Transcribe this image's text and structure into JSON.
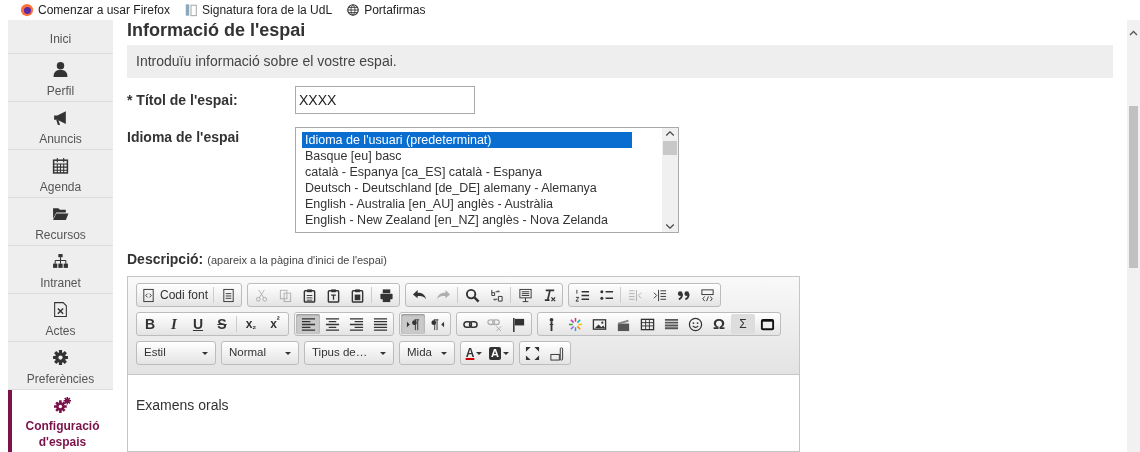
{
  "bookmarks": [
    {
      "label": "Comenzar a usar Firefox"
    },
    {
      "label": "Signatura fora de la UdL"
    },
    {
      "label": "Portafirmas"
    }
  ],
  "sidebar": {
    "items": [
      {
        "label": "Inici",
        "selected": false
      },
      {
        "label": "Perfil",
        "selected": false
      },
      {
        "label": "Anuncis",
        "selected": false
      },
      {
        "label": "Agenda",
        "selected": false
      },
      {
        "label": "Recursos",
        "selected": false
      },
      {
        "label": "Intranet",
        "selected": false
      },
      {
        "label": "Actes",
        "selected": false
      },
      {
        "label": "Preferències",
        "selected": false
      },
      {
        "label": "Configuració d'espais",
        "selected": true
      }
    ]
  },
  "heading": "Informació de l'espai",
  "info": "Introduïu informació sobre el vostre espai.",
  "title_field": {
    "label": "* Títol de l'espai:",
    "value": "XXXX"
  },
  "language_field": {
    "label": "Idioma de l'espai",
    "options": [
      {
        "label": "Idioma de l'usuari (predeterminat)",
        "selected": true
      },
      {
        "label": "Basque [eu] basc",
        "selected": false
      },
      {
        "label": "català - Espanya [ca_ES] català - Espanya",
        "selected": false
      },
      {
        "label": "Deutsch - Deutschland [de_DE] alemany - Alemanya",
        "selected": false
      },
      {
        "label": "English - Australia [en_AU] anglès - Austràlia",
        "selected": false
      },
      {
        "label": "English - New Zealand [en_NZ] anglès - Nova Zelanda",
        "selected": false
      }
    ]
  },
  "description": {
    "label": "Descripció:",
    "hint": "(apareix a la pàgina d'inici de l'espai)",
    "content": "Examens orals",
    "toolbar": {
      "rows": [
        {
          "groups": [
            {
              "items": [
                {
                  "kind": "labeled",
                  "label": "Codi font",
                  "active": false,
                  "disabled": false
                },
                {
                  "kind": "separator"
                },
                {
                  "kind": "icon",
                  "active": false,
                  "disabled": false
                }
              ]
            },
            {
              "items": [
                {
                  "kind": "icon",
                  "active": false,
                  "disabled": true
                },
                {
                  "kind": "icon",
                  "active": false,
                  "disabled": true
                },
                {
                  "kind": "icon",
                  "active": false,
                  "disabled": false
                },
                {
                  "kind": "icon",
                  "active": false,
                  "disabled": false
                },
                {
                  "kind": "icon",
                  "active": false,
                  "disabled": false
                },
                {
                  "kind": "separator"
                },
                {
                  "kind": "icon",
                  "active": false,
                  "disabled": false
                }
              ]
            },
            {
              "items": [
                {
                  "kind": "icon",
                  "active": false,
                  "disabled": false
                },
                {
                  "kind": "icon",
                  "active": false,
                  "disabled": true
                },
                {
                  "kind": "separator"
                },
                {
                  "kind": "icon",
                  "active": false,
                  "disabled": false
                },
                {
                  "kind": "icon",
                  "active": false,
                  "disabled": false
                },
                {
                  "kind": "separator"
                },
                {
                  "kind": "icon",
                  "active": false,
                  "disabled": false
                },
                {
                  "kind": "icon",
                  "active": false,
                  "disabled": false
                }
              ]
            },
            {
              "items": [
                {
                  "kind": "icon",
                  "active": false,
                  "disabled": false
                },
                {
                  "kind": "icon",
                  "active": false,
                  "disabled": false
                },
                {
                  "kind": "separator"
                },
                {
                  "kind": "icon",
                  "active": false,
                  "disabled": true
                },
                {
                  "kind": "icon",
                  "active": false,
                  "disabled": false
                },
                {
                  "kind": "icon",
                  "active": false,
                  "disabled": false
                },
                {
                  "kind": "icon",
                  "active": false,
                  "disabled": false
                }
              ]
            }
          ]
        },
        {
          "groups": [
            {
              "items": [
                {
                  "kind": "bold",
                  "label": "B",
                  "active": false,
                  "disabled": false
                },
                {
                  "kind": "italic",
                  "label": "I",
                  "active": false,
                  "disabled": false
                },
                {
                  "kind": "underline",
                  "label": "U",
                  "active": false,
                  "disabled": false
                },
                {
                  "kind": "strike",
                  "label": "S",
                  "active": false,
                  "disabled": false
                },
                {
                  "kind": "separator"
                },
                {
                  "kind": "script",
                  "label": "x$_{₂}$",
                  "active": false,
                  "disabled": false
                },
                {
                  "kind": "script",
                  "label": "x$^{²}$",
                  "active": false,
                  "disabled": false
                }
              ]
            },
            {
              "items": [
                {
                  "kind": "icon",
                  "active": true,
                  "disabled": false
                },
                {
                  "kind": "icon",
                  "active": false,
                  "disabled": false
                },
                {
                  "kind": "icon",
                  "active": false,
                  "disabled": false
                },
                {
                  "kind": "icon",
                  "active": false,
                  "disabled": false
                }
              ]
            },
            {
              "items": [
                {
                  "kind": "icon",
                  "active": true,
                  "disabled": false
                },
                {
                  "kind": "icon",
                  "active": false,
                  "disabled": false
                }
              ]
            },
            {
              "items": [
                {
                  "kind": "icon",
                  "active": false,
                  "disabled": false
                },
                {
                  "kind": "icon",
                  "active": false,
                  "disabled": true
                },
                {
                  "kind": "icon",
                  "active": false,
                  "disabled": false
                }
              ]
            },
            {
              "items": [
                {
                  "kind": "icon",
                  "active": false,
                  "disabled": false
                },
                {
                  "kind": "icon",
                  "active": false,
                  "disabled": false
                },
                {
                  "kind": "icon",
                  "active": false,
                  "disabled": false
                },
                {
                  "kind": "icon",
                  "active": false,
                  "disabled": false
                },
                {
                  "kind": "icon",
                  "active": false,
                  "disabled": false
                },
                {
                  "kind": "icon",
                  "active": false,
                  "disabled": false
                },
                {
                  "kind": "icon",
                  "active": false,
                  "disabled": false
                },
                {
                  "kind": "symbol",
                  "label": "Ω",
                  "active": false,
                  "disabled": false
                },
                {
                  "kind": "sigma",
                  "label": "Σ",
                  "active": false,
                  "disabled": false
                },
                {
                  "kind": "icon",
                  "active": false,
                  "disabled": false
                }
              ]
            }
          ]
        },
        {
          "groups": [
            {
              "items": [
                {
                  "kind": "combo",
                  "label": "Estil"
                }
              ]
            },
            {
              "items": [
                {
                  "kind": "combo",
                  "label": "Normal"
                }
              ]
            },
            {
              "items": [
                {
                  "kind": "combo",
                  "label": "Tipus de…"
                }
              ]
            },
            {
              "items": [
                {
                  "kind": "combo",
                  "label": "Mida"
                }
              ]
            },
            {
              "items": [
                {
                  "kind": "color",
                  "label": "A",
                  "active": false,
                  "disabled": false
                },
                {
                  "kind": "bgcolor",
                  "label": "A",
                  "active": false,
                  "disabled": false
                }
              ]
            },
            {
              "items": [
                {
                  "kind": "icon",
                  "active": false,
                  "disabled": false
                },
                {
                  "kind": "icon",
                  "active": false,
                  "disabled": false
                }
              ]
            }
          ]
        }
      ]
    }
  }
}
